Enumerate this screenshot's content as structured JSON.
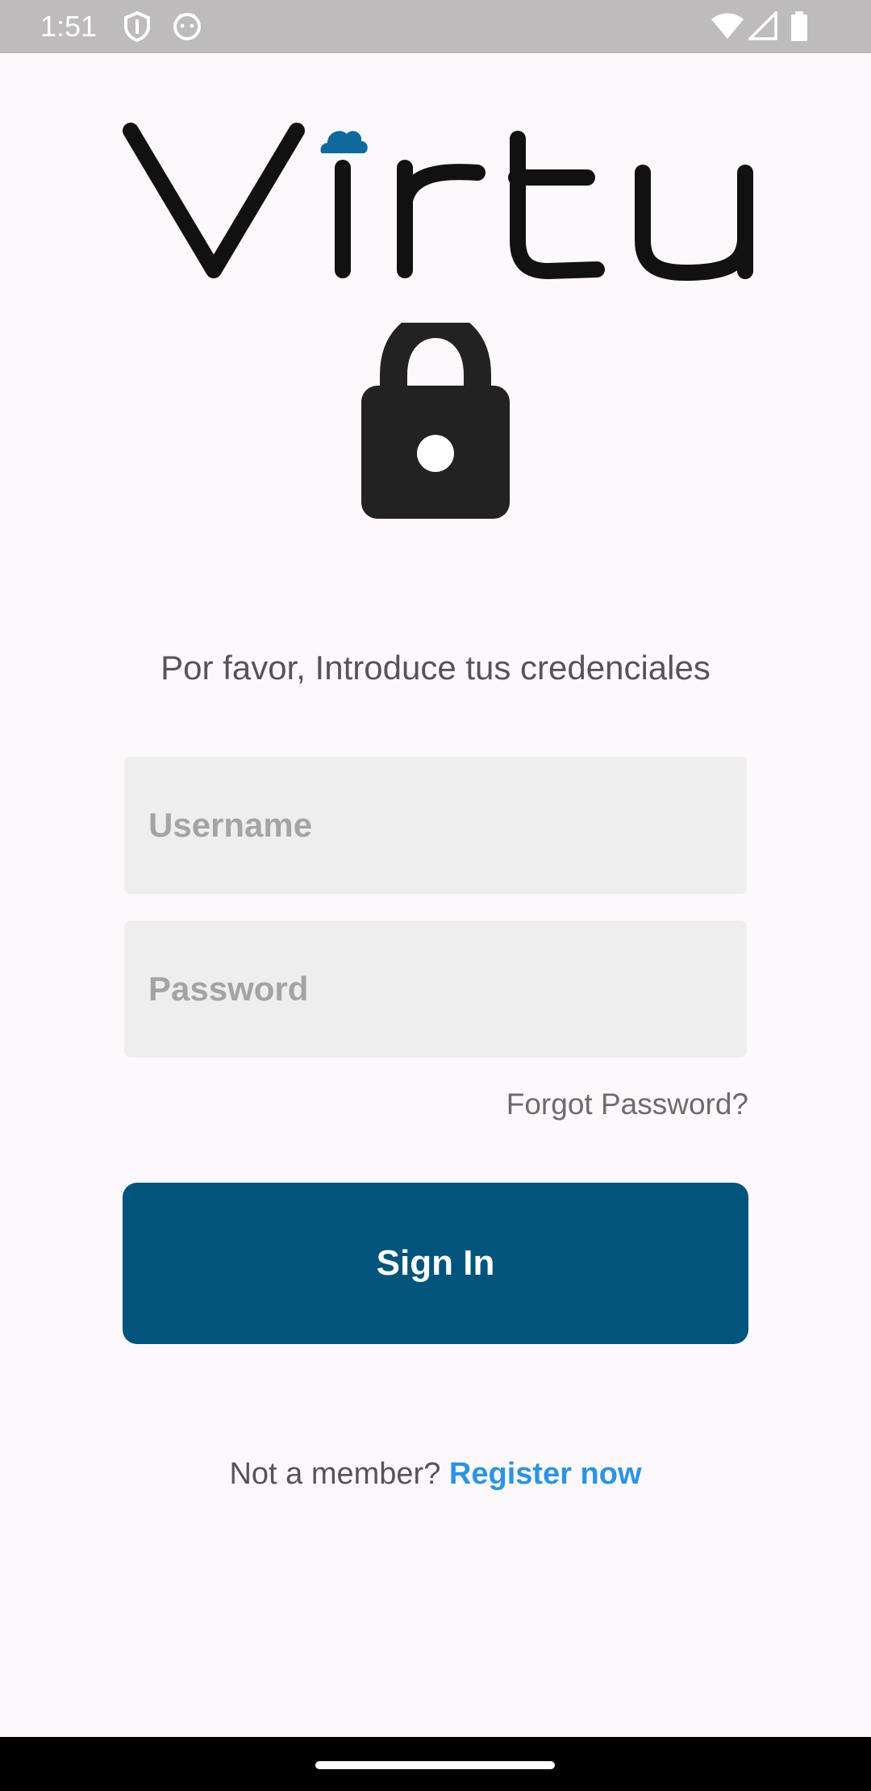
{
  "status_bar": {
    "time": "1:51",
    "icons": [
      "shield-icon",
      "android-icon",
      "wifi-icon",
      "signal-icon",
      "battery-icon"
    ]
  },
  "logo": {
    "text": "Virtu",
    "icon": "cloud-icon",
    "accent_color": "#0e6a9c"
  },
  "lock": {
    "icon": "lock-icon"
  },
  "prompt": "Por favor, Introduce tus credenciales",
  "username": {
    "placeholder": "Username",
    "value": ""
  },
  "password": {
    "placeholder": "Password",
    "value": ""
  },
  "forgot_password": "Forgot Password?",
  "sign_in": {
    "label": "Sign In",
    "color": "#02547c"
  },
  "register": {
    "prompt": "Not a member?",
    "link": "Register now",
    "link_color": "#2b93e5"
  }
}
